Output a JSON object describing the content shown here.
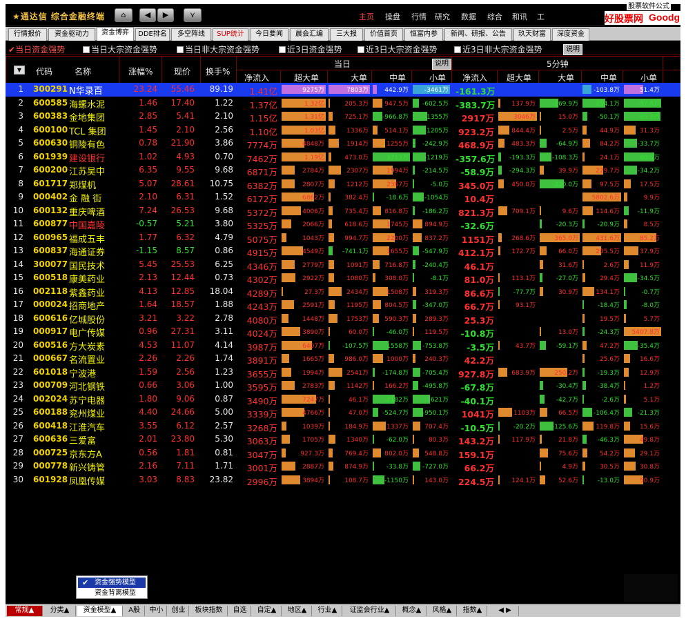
{
  "app": {
    "title": "★通达信 综合金融终端",
    "corner_text": "股票软件公式",
    "watermark_cn": "好股票网",
    "watermark_en": "Goodgupiao.com"
  },
  "nav": {
    "home_icon": "home-icon",
    "back_icon": "◀",
    "fwd_icon": "▶",
    "down_icon": "⯯"
  },
  "main_menu": [
    "主页",
    "操盘",
    "行情",
    "研究",
    "数据",
    "综合",
    "和讯",
    "工"
  ],
  "tabs": [
    {
      "label": "行情报价",
      "active": false,
      "red": false
    },
    {
      "label": "资金驱动力",
      "active": false,
      "red": false
    },
    {
      "label": "资金博弈",
      "active": true,
      "red": false
    },
    {
      "label": "DDE排名",
      "active": false,
      "red": false
    },
    {
      "label": "多空阵线",
      "active": false,
      "red": false
    },
    {
      "label": "SUP统计",
      "active": false,
      "red": true
    },
    {
      "label": "今日要闻",
      "active": false,
      "red": false
    },
    {
      "label": "晨会汇编",
      "active": false,
      "red": false
    },
    {
      "label": "三大报",
      "active": false,
      "red": false
    },
    {
      "label": "价值首页",
      "active": false,
      "red": false
    },
    {
      "label": "恒富内参",
      "active": false,
      "red": false
    },
    {
      "label": "新闻、研报、公告",
      "active": false,
      "red": false
    },
    {
      "label": "玖天财富",
      "active": false,
      "red": false
    },
    {
      "label": "深度资金",
      "active": false,
      "red": false
    }
  ],
  "filters": [
    {
      "label": "当日资金强势",
      "selected": true
    },
    {
      "label": "当日大宗资金强势",
      "selected": false
    },
    {
      "label": "当日非大宗资金强势",
      "selected": false
    },
    {
      "label": "近3日资金强势",
      "selected": false
    },
    {
      "label": "近3日大宗资金强势",
      "selected": false
    },
    {
      "label": "近3日非大宗资金强势",
      "selected": false
    }
  ],
  "explain_label": "说明",
  "columns": {
    "code": "代码",
    "name": "名称",
    "chg": "涨幅%",
    "price": "现价",
    "turn": "换手%",
    "today": "当日",
    "min5": "5分钟",
    "net": "净流入",
    "xl": "超大单",
    "l": "大单",
    "m": "中单",
    "s": "小单"
  },
  "rows": [
    {
      "n": "1",
      "code": "300291",
      "name": "N华录百",
      "nc": "white",
      "chg": "23.24",
      "price": "55.46",
      "turn": "89.19",
      "net": "1.41亿",
      "xl": "9275万",
      "l": "7803万",
      "m": "442.9万",
      "s": "-3461万",
      "net5": "-161.3万",
      "xl5": "",
      "l5": "",
      "m5": "-103.8万",
      "s5": "51.4万"
    },
    {
      "n": "2",
      "code": "600585",
      "name": "海螺水泥",
      "nc": "",
      "chg": "1.46",
      "price": "17.40",
      "turn": "1.22",
      "net": "1.37亿",
      "xl": "1.32亿",
      "l": "205.3万",
      "m": "947.5万",
      "s": "-602.5万",
      "net5": "-383.7万",
      "xl5": "137.9万",
      "l5": "-169.9万",
      "m5": "-254.1万",
      "s5": "-97.6万"
    },
    {
      "n": "3",
      "code": "600383",
      "name": "金地集团",
      "nc": "",
      "chg": "2.85",
      "price": "5.41",
      "turn": "2.10",
      "net": "1.15亿",
      "xl": "1.31亿",
      "l": "725.1万",
      "m": "-966.8万",
      "s": "-1355万",
      "net5": "2917万",
      "xl5": "3046万",
      "l5": "15.0万",
      "m5": "-50.1万",
      "s5": "-95.3万"
    },
    {
      "n": "4",
      "code": "600100",
      "name": "TCL 集团",
      "nc": "",
      "chg": "1.45",
      "price": "2.10",
      "turn": "2.56",
      "net": "1.10亿",
      "xl": "1.03亿",
      "l": "1336万",
      "m": "514.1万",
      "s": "-1205万",
      "net5": "923.2万",
      "xl5": "844.4万",
      "l5": "2.5万",
      "m5": "44.9万",
      "s5": "31.3万"
    },
    {
      "n": "5",
      "code": "600630",
      "name": "铜陵有色",
      "nc": "",
      "chg": "0.78",
      "price": "21.90",
      "turn": "3.86",
      "net": "7774万",
      "xl": "4848万",
      "l": "1914万",
      "m": "1255万",
      "s": "-242.9万",
      "net5": "468.9万",
      "xl5": "483.3万",
      "l5": "-64.9万",
      "m5": "84.2万",
      "s5": "-33.7万"
    },
    {
      "n": "6",
      "code": "601939",
      "name": "建设银行",
      "nc": "red",
      "chg": "1.02",
      "price": "4.93",
      "turn": "0.70",
      "net": "7462万",
      "xl": "1.19亿",
      "l": "473.0万",
      "m": "-3713万",
      "s": "-1219万",
      "net5": "-357.6万",
      "xl5": "-193.3万",
      "l5": "-108.3万",
      "m5": "24.1万",
      "s5": "-80.0万"
    },
    {
      "n": "7",
      "code": "600200",
      "name": "江苏吴中",
      "nc": "",
      "chg": "6.35",
      "price": "9.55",
      "turn": "9.68",
      "net": "6871万",
      "xl": "2784万",
      "l": "2307万",
      "m": "1994万",
      "s": "-214.5万",
      "net5": "-58.9万",
      "xl5": "-294.3万",
      "l5": "39.9万",
      "m5": "229.7万",
      "s5": "-34.2万"
    },
    {
      "n": "8",
      "code": "601717",
      "name": "郑煤机",
      "nc": "",
      "chg": "5.07",
      "price": "28.61",
      "turn": "10.75",
      "net": "6382万",
      "xl": "2807万",
      "l": "1212万",
      "m": "2367万",
      "s": "-5.0万",
      "net5": "345.0万",
      "xl5": "450.0万",
      "l5": "-220.0万",
      "m5": "97.5万",
      "s5": "17.5万"
    },
    {
      "n": "9",
      "code": "000402",
      "name": "金 融 街",
      "nc": "",
      "chg": "2.10",
      "price": "6.31",
      "turn": "1.52",
      "net": "6172万",
      "xl": "6862万",
      "l": "382.4万",
      "m": "-18.6万",
      "s": "-1054万",
      "net5": "10.4万",
      "xl5": "",
      "l5": "",
      "m5": "5802.6万",
      "s5": "9.9万"
    },
    {
      "n": "10",
      "code": "600132",
      "name": "重庆啤酒",
      "nc": "",
      "chg": "7.24",
      "price": "26.53",
      "turn": "9.68",
      "net": "5372万",
      "xl": "4006万",
      "l": "735.4万",
      "m": "816.8万",
      "s": "-186.2万",
      "net5": "821.3万",
      "xl5": "709.1万",
      "l5": "9.6万",
      "m5": "114.6万",
      "s5": "-11.9万"
    },
    {
      "n": "11",
      "code": "600877",
      "name": "中国嘉陵",
      "nc": "red",
      "chg": "-0.57",
      "price": "5.21",
      "turn": "3.80",
      "net": "5325万",
      "xl": "2066万",
      "l": "618.6万",
      "m": "1745万",
      "s": "894.9万",
      "net5": "-32.6万",
      "xl5": "",
      "l5": "-20.3万",
      "m5": "-20.9万",
      "s5": "8.5万"
    },
    {
      "n": "12",
      "code": "600965",
      "name": "福成五丰",
      "nc": "",
      "chg": "1.77",
      "price": "6.32",
      "turn": "4.79",
      "net": "5075万",
      "xl": "1043万",
      "l": "994.7万",
      "m": "2200万",
      "s": "837.2万",
      "net5": "1151万",
      "xl5": "268.6万",
      "l5": "365.0万",
      "m5": "431.6万",
      "s5": "85.2万"
    },
    {
      "n": "13",
      "code": "600837",
      "name": "海通证券",
      "nc": "",
      "chg": "-1.15",
      "price": "8.57",
      "turn": "0.86",
      "net": "4915万",
      "xl": "4549万",
      "l": "-741.1万",
      "m": "1655万",
      "s": "-547.9万",
      "net5": "412.1万",
      "xl5": "172.7万",
      "l5": "66.0万",
      "m5": "205.5万",
      "s5": "37.9万"
    },
    {
      "n": "14",
      "code": "300077",
      "name": "国民技术",
      "nc": "",
      "chg": "5.45",
      "price": "25.53",
      "turn": "6.25",
      "net": "4346万",
      "xl": "2779万",
      "l": "1091万",
      "m": "716.8万",
      "s": "-240.4万",
      "net5": "46.1万",
      "xl5": "",
      "l5": "31.6万",
      "m5": "2.6万",
      "s5": "11.9万"
    },
    {
      "n": "15",
      "code": "600518",
      "name": "康美药业",
      "nc": "",
      "chg": "2.13",
      "price": "12.44",
      "turn": "0.73",
      "net": "4302万",
      "xl": "2922万",
      "l": "1080万",
      "m": "308.0万",
      "s": "-8.1万",
      "net5": "81.0万",
      "xl5": "113.1万",
      "l5": "-27.0万",
      "m5": "29.4万",
      "s5": "-34.5万"
    },
    {
      "n": "16",
      "code": "002118",
      "name": "紫鑫药业",
      "nc": "",
      "chg": "4.13",
      "price": "12.85",
      "turn": "18.04",
      "net": "4289万",
      "xl": "27.3万",
      "l": "2434万",
      "m": "1508万",
      "s": "319.3万",
      "net5": "86.6万",
      "xl5": "-77.7万",
      "l5": "30.9万",
      "m5": "134.1万",
      "s5": "-0.7万"
    },
    {
      "n": "17",
      "code": "000024",
      "name": "招商地产",
      "nc": "",
      "chg": "1.64",
      "price": "18.57",
      "turn": "1.88",
      "net": "4243万",
      "xl": "2591万",
      "l": "1195万",
      "m": "804.5万",
      "s": "-347.0万",
      "net5": "66.7万",
      "xl5": "93.1万",
      "l5": "",
      "m5": "-18.4万",
      "s5": "-8.0万"
    },
    {
      "n": "18",
      "code": "600616",
      "name": "亿城股份",
      "nc": "",
      "chg": "3.21",
      "price": "3.22",
      "turn": "2.78",
      "net": "4080万",
      "xl": "1448万",
      "l": "1753万",
      "m": "590.3万",
      "s": "289.3万",
      "net5": "25.3万",
      "xl5": "",
      "l5": "",
      "m5": "19.5万",
      "s5": "5.7万"
    },
    {
      "n": "19",
      "code": "000917",
      "name": "电广传媒",
      "nc": "",
      "chg": "0.96",
      "price": "27.31",
      "turn": "3.11",
      "net": "4024万",
      "xl": "3890万",
      "l": "60.0万",
      "m": "-46.0万",
      "s": "119.5万",
      "net5": "-10.8万",
      "xl5": "",
      "l5": "13.0万",
      "m5": "-24.3万",
      "s5": "5407.8万"
    },
    {
      "n": "20",
      "code": "600516",
      "name": "方大炭素",
      "nc": "",
      "chg": "4.53",
      "price": "11.07",
      "turn": "4.14",
      "net": "3987万",
      "xl": "6407万",
      "l": "-107.5万",
      "m": "-1558万",
      "s": "-753.8万",
      "net5": "-3.5万",
      "xl5": "43.7万",
      "l5": "-59.1万",
      "m5": "47.2万",
      "s5": "-35.4万"
    },
    {
      "n": "21",
      "code": "000667",
      "name": "名流置业",
      "nc": "",
      "chg": "2.26",
      "price": "2.26",
      "turn": "1.74",
      "net": "3891万",
      "xl": "1665万",
      "l": "986.0万",
      "m": "1000万",
      "s": "240.3万",
      "net5": "42.2万",
      "xl5": "",
      "l5": "",
      "m5": "25.6万",
      "s5": "16.6万"
    },
    {
      "n": "22",
      "code": "601018",
      "name": "宁波港",
      "nc": "",
      "chg": "1.59",
      "price": "2.56",
      "turn": "1.23",
      "net": "3655万",
      "xl": "1994万",
      "l": "2541万",
      "m": "-174.8万",
      "s": "-705.4万",
      "net5": "927.8万",
      "xl5": "683.9万",
      "l5": "250.2万",
      "m5": "-19.3万",
      "s5": "12.9万"
    },
    {
      "n": "23",
      "code": "000709",
      "name": "河北钢铁",
      "nc": "",
      "chg": "0.66",
      "price": "3.06",
      "turn": "1.00",
      "net": "3595万",
      "xl": "2783万",
      "l": "1142万",
      "m": "166.2万",
      "s": "-495.8万",
      "net5": "-67.8万",
      "xl5": "",
      "l5": "-30.4万",
      "m5": "-38.4万",
      "s5": "1.2万"
    },
    {
      "n": "24",
      "code": "002024",
      "name": "苏宁电器",
      "nc": "",
      "chg": "1.80",
      "price": "9.06",
      "turn": "0.87",
      "net": "3490万",
      "xl": "7247万",
      "l": "46.1万",
      "m": "-2182万",
      "s": "-1621万",
      "net5": "-40.1万",
      "xl5": "",
      "l5": "-42.7万",
      "m5": "-2.6万",
      "s5": "5.1万"
    },
    {
      "n": "25",
      "code": "600188",
      "name": "兖州煤业",
      "nc": "",
      "chg": "4.40",
      "price": "24.66",
      "turn": "5.00",
      "net": "3339万",
      "xl": "4766万",
      "l": "47.0万",
      "m": "-524.7万",
      "s": "-950.1万",
      "net5": "1041万",
      "xl5": "1103万",
      "l5": "66.5万",
      "m5": "-106.4万",
      "s5": "-21.3万"
    },
    {
      "n": "26",
      "code": "600418",
      "name": "江淮汽车",
      "nc": "",
      "chg": "3.55",
      "price": "6.12",
      "turn": "2.57",
      "net": "3268万",
      "xl": "1039万",
      "l": "184.9万",
      "m": "1337万",
      "s": "707.4万",
      "net5": "-10.5万",
      "xl5": "-20.2万",
      "l5": "-125.6万",
      "m5": "119.8万",
      "s5": "15.6万"
    },
    {
      "n": "27",
      "code": "600636",
      "name": "三爱富",
      "nc": "",
      "chg": "2.01",
      "price": "23.80",
      "turn": "5.30",
      "net": "3063万",
      "xl": "1705万",
      "l": "1340万",
      "m": "-62.0万",
      "s": "80.3万",
      "net5": "143.2万",
      "xl5": "117.9万",
      "l5": "21.8万",
      "m5": "-46.3万",
      "s5": "49.8万"
    },
    {
      "n": "28",
      "code": "000725",
      "name": "京东方A",
      "nc": "",
      "chg": "0.56",
      "price": "1.81",
      "turn": "0.81",
      "net": "3047万",
      "xl": "927.3万",
      "l": "769.4万",
      "m": "802.0万",
      "s": "548.8万",
      "net5": "159.1万",
      "xl5": "",
      "l5": "75.6万",
      "m5": "54.2万",
      "s5": "29.1万"
    },
    {
      "n": "29",
      "code": "000778",
      "name": "新兴铸管",
      "nc": "",
      "chg": "2.16",
      "price": "7.11",
      "turn": "1.71",
      "net": "3001万",
      "xl": "2887万",
      "l": "874.9万",
      "m": "-33.8万",
      "s": "-727.0万",
      "net5": "66.2万",
      "xl5": "",
      "l5": "4.9万",
      "m5": "30.5万",
      "s5": "30.8万"
    },
    {
      "n": "30",
      "code": "601928",
      "name": "凤凰传媒",
      "nc": "",
      "chg": "3.03",
      "price": "8.83",
      "turn": "23.82",
      "net": "2996万",
      "xl": "3894万",
      "l": "108.7万",
      "m": "-1150万",
      "s": "143.0万",
      "net5": "224.5万",
      "xl5": "124.1万",
      "l5": "52.6万",
      "m5": "-13.0万",
      "s5": "50.9万"
    }
  ],
  "popup": {
    "items": [
      {
        "label": "资金强势模型",
        "checked": true
      },
      {
        "label": "资金背离模型",
        "checked": false
      }
    ]
  },
  "bottom_tabs": [
    {
      "label": "常规▲",
      "red": true
    },
    {
      "label": "分类▲",
      "red": false
    },
    {
      "label": "资金模型▲",
      "red": false,
      "active": true
    },
    {
      "label": "A股",
      "red": false
    },
    {
      "label": "中小",
      "red": false
    },
    {
      "label": "创业",
      "red": false
    },
    {
      "label": "板块指数",
      "red": false
    },
    {
      "label": "自选",
      "red": false
    },
    {
      "label": "自定▲",
      "red": false
    },
    {
      "label": "地区▲",
      "red": false
    },
    {
      "label": "行业▲",
      "red": false
    },
    {
      "label": "证监会行业▲",
      "red": false
    },
    {
      "label": "概念▲",
      "red": false
    },
    {
      "label": "风格▲",
      "red": false
    },
    {
      "label": "指数▲",
      "red": false
    }
  ],
  "colors": {
    "bg": "#000000",
    "pos_bar": "#e08a30",
    "neg_bar": "#3fc03f",
    "sel_row": "#1a3af0",
    "up": "#ff3030",
    "down": "#30e030"
  }
}
